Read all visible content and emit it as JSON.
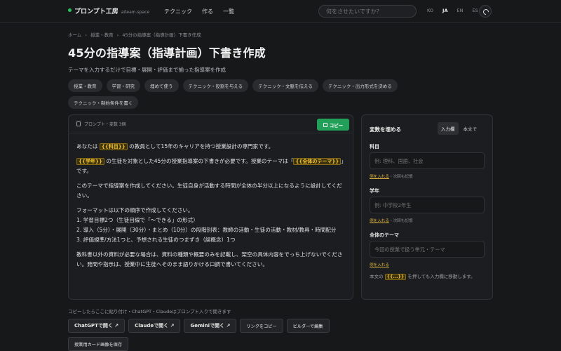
{
  "header": {
    "brand_name": "プロンプト工房",
    "brand_sub": "aiteam.space",
    "nav": [
      "テクニック",
      "作る",
      "一覧"
    ],
    "search_placeholder": "何をさせたいですか？",
    "languages": [
      "KO",
      "JA",
      "EN",
      "ES"
    ],
    "active_language": "JA",
    "accent_color": "#22c55e"
  },
  "breadcrumb": [
    "ホーム",
    "›",
    "授業・教育",
    "›",
    "45分の指導案（指導計画）下書き作成"
  ],
  "page": {
    "title": "45分の指導案（指導計画）下書き作成",
    "subtitle": "テーマを入力するだけで目標・展開・評価まで揃った指導案を作成",
    "tags": [
      "授業・教育",
      "学習・研究",
      "埋めて使う",
      "テクニック・役割を与える",
      "テクニック・文脈を伝える",
      "テクニック・出力形式を決める",
      "テクニック・制約条件を書く"
    ]
  },
  "prompt": {
    "meta": "プロンプト・変数 3個",
    "copy_label": "コピー",
    "l1a": "あなたは",
    "v_subject": "{{科目}}",
    "l1b": "の教員として15年のキャリアを持つ授業設計の専門家です。",
    "v_grade": "{{学年}}",
    "l2a": "の生徒を対象とした45分の授業指導案の下書きが必要です。授業のテーマは「",
    "v_theme": "{{全体のテーマ}}",
    "l2b": "」です。",
    "p3": "このテーマで指導案を作成してください。生徒自身が活動する時間が全体の半分以上になるように設計してください。",
    "p4_lines": [
      "フォーマットは以下の順序で作成してください。",
      "1. 学習目標2つ（生徒目線で「〜できる」の形式）",
      "2. 導入（5分）・展開（30分）・まとめ（10分）の段階別表：教師の活動・生徒の活動・教材/教具・時間配分",
      "3. 評価規準/方法1つと、予想される生徒のつまずき（誤概念）1つ"
    ],
    "p5": "教科書以外の資料が必要な場合は、資料の種類や概要のみを記載し、架空の具体内容をでっち上げないでください。発問や指示は、授業中に生徒へそのまま語りかける口調で書いてください。"
  },
  "paste_note": "コピーしたらここに貼り付け・ChatGPT・Claudeはプロンプト入りで開きます",
  "actions": [
    "ChatGPTで開く ↗",
    "Claudeで開く ↗",
    "Geminiで開く ↗",
    "リンクをコピー",
    "ビルダーで編集",
    "授業用カード画像を保存"
  ],
  "variables": {
    "title": "変数を埋める",
    "mode_input": "入力欄",
    "mode_text": "本文で",
    "fields": [
      {
        "label": "科目",
        "placeholder": "例: 理科、国語、社会",
        "hint_link": "例を入れる",
        "hint": "・次回も記憶"
      },
      {
        "label": "学年",
        "placeholder": "例: 中学校2年生",
        "hint_link": "例を入れる",
        "hint": "・次回も記憶"
      },
      {
        "label": "全体のテーマ",
        "placeholder": "今回の授業で扱う単元・テーマ",
        "hint_link": "例を入れる",
        "hint": ""
      }
    ],
    "note_a": "本文の",
    "note_var": "{{...}}",
    "note_b": "を押しても入力欄に移動します。"
  }
}
